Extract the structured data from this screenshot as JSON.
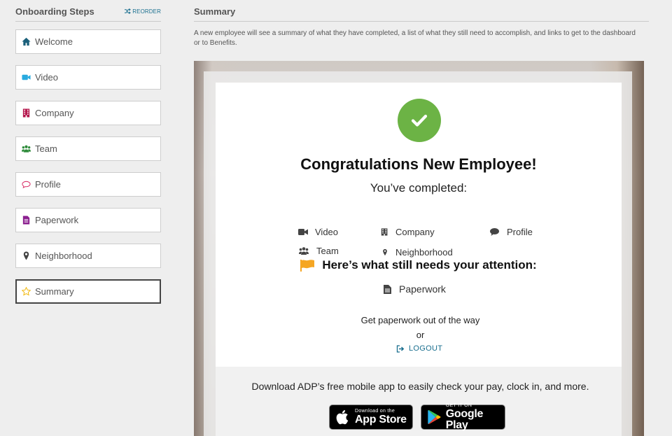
{
  "sidebar": {
    "title": "Onboarding Steps",
    "reorder_label": "REORDER",
    "items": [
      {
        "label": "Welcome",
        "icon": "home-icon",
        "color": "#1a5f7a"
      },
      {
        "label": "Video",
        "icon": "video-camera-icon",
        "color": "#29aadf"
      },
      {
        "label": "Company",
        "icon": "building-icon",
        "color": "#b4154b"
      },
      {
        "label": "Team",
        "icon": "team-icon",
        "color": "#2e8b3a"
      },
      {
        "label": "Profile",
        "icon": "speech-bubble-icon",
        "color": "#d9356b"
      },
      {
        "label": "Paperwork",
        "icon": "document-icon",
        "color": "#8b1f8f"
      },
      {
        "label": "Neighborhood",
        "icon": "map-pin-icon",
        "color": "#444444"
      },
      {
        "label": "Summary",
        "icon": "star-icon",
        "color": "#f0b400",
        "active": true
      }
    ]
  },
  "main": {
    "title": "Summary",
    "description": "A new employee will see a summary of what they have completed, a list of what they still need to accomplish, and links to get to the dashboard or to Benefits."
  },
  "preview": {
    "congrats_title": "Congratulations New Employee!",
    "completed_label": "You’ve completed:",
    "completed_items": [
      {
        "label": "Video",
        "icon": "video-camera-icon"
      },
      {
        "label": "Company",
        "icon": "building-icon"
      },
      {
        "label": "Profile",
        "icon": "speech-bubble-icon"
      },
      {
        "label": "Team",
        "icon": "team-icon"
      },
      {
        "label": "Neighborhood",
        "icon": "map-pin-icon"
      }
    ],
    "attention_title": "Here’s what still needs your attention:",
    "attention_items": [
      {
        "label": "Paperwork",
        "icon": "document-icon"
      }
    ],
    "get_paperwork_text": "Get paperwork out of the way",
    "or_text": "or",
    "logout_label": "LOGOUT",
    "app_promo_text": "Download ADP’s free mobile app to easily check your pay, clock in, and more.",
    "app_store": {
      "small": "Download on the",
      "big": "App Store"
    },
    "google_play": {
      "small": "GET IT ON",
      "big": "Google Play"
    },
    "colors": {
      "success": "#6cb345",
      "flag": "#f5a623",
      "link": "#1a6f8f"
    }
  }
}
